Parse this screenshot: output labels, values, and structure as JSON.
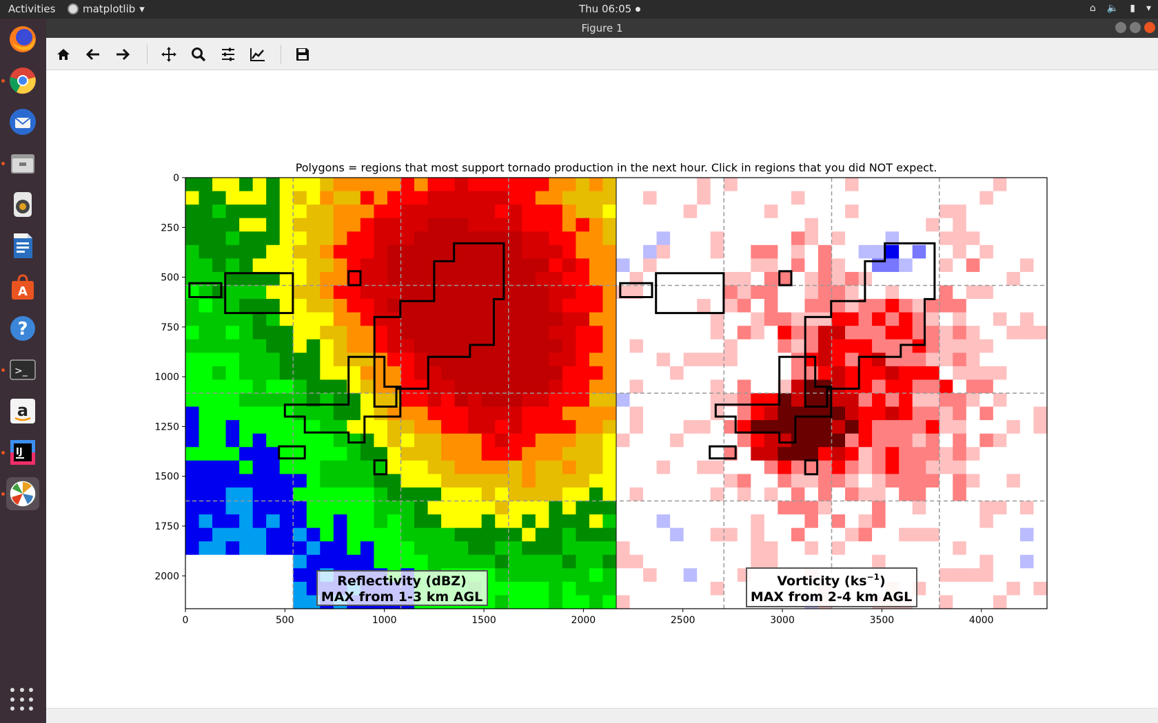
{
  "topbar": {
    "activities": "Activities",
    "app_name": "matplotlib",
    "clock": "Thu 06:05"
  },
  "window": {
    "title": "Figure 1"
  },
  "toolbar": {
    "buttons": [
      "home-icon",
      "back-arrow-icon",
      "forward-arrow-icon",
      "pan-icon",
      "zoom-icon",
      "subplots-config-icon",
      "edit-axes-icon",
      "save-icon"
    ]
  },
  "dock": {
    "items": [
      "firefox-icon",
      "chrome-icon",
      "thunderbird-icon",
      "files-icon",
      "rhythmbox-icon",
      "writer-icon",
      "software-center-icon",
      "help-icon",
      "terminal-icon",
      "amazon-icon",
      "intellij-icon",
      "matplotlib-icon"
    ]
  },
  "figure": {
    "title": "Polygons = regions that most support tornado production in the next hour.  Click in regions that you did NOT expect.",
    "panel_left_label_1": "Reflectivity (dBZ)",
    "panel_left_label_2": "MAX from 1-3 km AGL",
    "panel_right_label_1": "Vorticity (ks",
    "panel_right_label_sup": "−1",
    "panel_right_label_close": ")",
    "panel_right_label_2": "MAX from 2-4 km AGL"
  },
  "chart_data": {
    "type": "heatmap",
    "title": "Polygons = regions that most support tornado production in the next hour.  Click in regions that you did NOT expect.",
    "x_ticks": [
      0,
      500,
      1000,
      1500,
      2000,
      2500,
      3000,
      3500,
      4000
    ],
    "y_ticks": [
      0,
      250,
      500,
      750,
      1000,
      1250,
      1500,
      1750,
      2000
    ],
    "xlim": [
      0,
      4330
    ],
    "ylim": [
      2165,
      0
    ],
    "grid": "dashed gray",
    "panels": [
      {
        "label": "Reflectivity (dBZ) MAX from 1-3 km AGL",
        "xlim": [
          0,
          2165
        ],
        "colors": [
          "#ffffff",
          "#00e5e5",
          "#009ef0",
          "#0000f0",
          "#00ff00",
          "#00c800",
          "#008c00",
          "#ffff00",
          "#e6bd00",
          "#ff9000",
          "#ff0000",
          "#d60000",
          "#c00000"
        ]
      },
      {
        "label": "Vorticity (ks−1) MAX from 2-4 km AGL",
        "xlim": [
          2165,
          4330
        ],
        "colors": [
          "#0000ee",
          "#7777ff",
          "#bbbbff",
          "#ffffff",
          "#ffc0c0",
          "#ff8080",
          "#ff0000",
          "#cc0000",
          "#6a0000"
        ]
      }
    ]
  }
}
